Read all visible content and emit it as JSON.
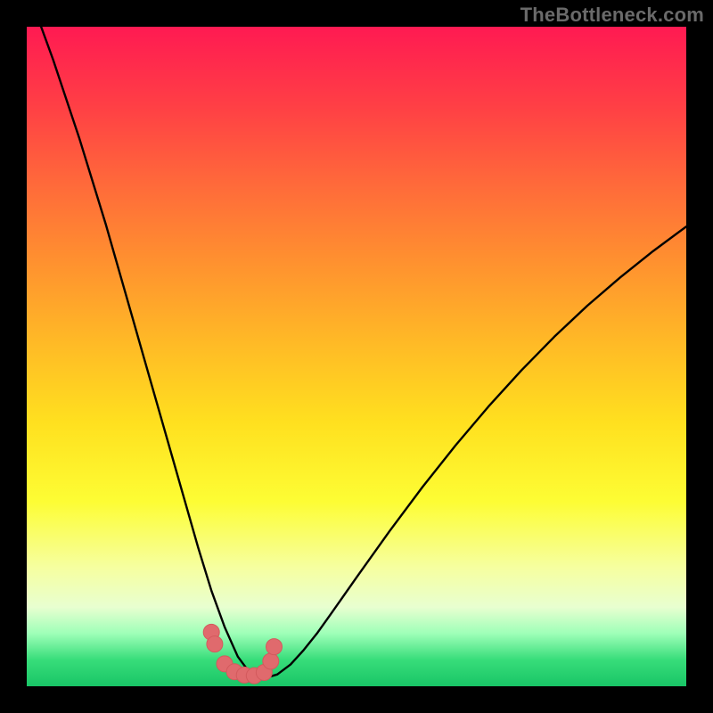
{
  "watermark": "TheBottleneck.com",
  "colors": {
    "curve_stroke": "#000000",
    "marker_fill": "#e06a6d",
    "marker_stroke": "#d35a5d",
    "background": "#000000"
  },
  "chart_data": {
    "type": "line",
    "title": "",
    "xlabel": "",
    "ylabel": "",
    "xlim": [
      0,
      100
    ],
    "ylim": [
      0,
      100
    ],
    "x": [
      0,
      2,
      4,
      6,
      8,
      10,
      12,
      14,
      16,
      18,
      20,
      22,
      24,
      26,
      28,
      30,
      32,
      34,
      35,
      36,
      38,
      40,
      42,
      44,
      46,
      50,
      55,
      60,
      65,
      70,
      75,
      80,
      85,
      90,
      95,
      100
    ],
    "y": [
      105,
      100.5,
      95,
      89,
      83,
      76.5,
      70,
      63,
      56,
      49,
      42,
      35,
      28,
      21,
      14.5,
      9,
      4.5,
      1.8,
      1.2,
      1.2,
      1.8,
      3.3,
      5.5,
      8,
      10.8,
      16.5,
      23.5,
      30.2,
      36.5,
      42.4,
      47.9,
      53,
      57.7,
      62,
      66,
      69.7
    ],
    "markers": {
      "x": [
        28,
        28.5,
        30,
        31.5,
        33,
        34.5,
        36,
        37,
        37.5
      ],
      "y": [
        8.2,
        6.4,
        3.4,
        2.2,
        1.7,
        1.6,
        2.1,
        3.8,
        6.0
      ]
    }
  }
}
